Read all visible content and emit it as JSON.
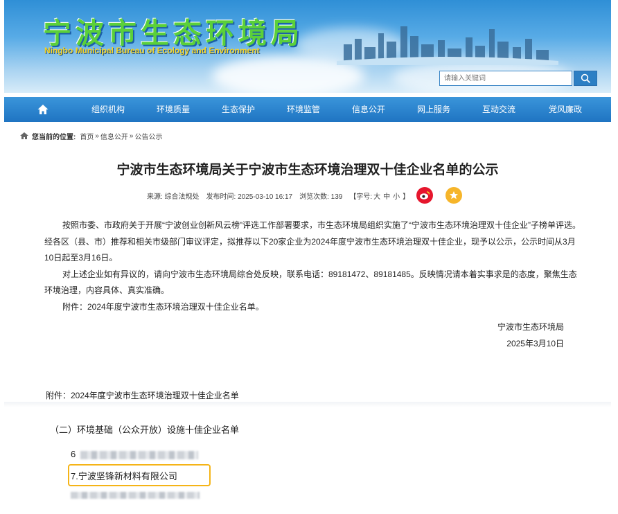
{
  "header": {
    "title_cn": "宁波市生态环境局",
    "title_en": "Ningbo Municipal Bureau of Ecology and Environment",
    "search_placeholder": "请输入关键词"
  },
  "nav": {
    "items": [
      "组织机构",
      "环境质量",
      "生态保护",
      "环境监管",
      "信息公开",
      "网上服务",
      "互动交流",
      "党风廉政"
    ]
  },
  "breadcrumb": {
    "label": "您当前的位置:",
    "home": "首页",
    "sep": "»",
    "level1": "信息公开",
    "level2": "公告公示"
  },
  "article": {
    "title": "宁波市生态环境局关于宁波市生态环境治理双十佳企业名单的公示",
    "meta": {
      "source": "来源:  综合法规处",
      "published": "发布时间:  2025-03-10 16:17",
      "views": "浏览次数:  139",
      "font_label": "【字号:",
      "font_large": "大",
      "font_medium": "中",
      "font_small": "小",
      "font_close": "】"
    },
    "paragraphs": [
      "按照市委、市政府关于开展“宁波创业创新风云榜”评选工作部署要求，市生态环境局组织实施了“宁波市生态环境治理双十佳企业”子榜单评选。经各区（县、市）推荐和相关市级部门审议评定，拟推荐以下20家企业为2024年度宁波市生态环境治理双十佳企业，现予以公示，公示时间从3月10日起至3月16日。",
      "对上述企业如有异议的，请向宁波市生态环境局综合处反映，联系电话：89181472、89181485。反映情况请本着实事求是的态度，聚焦生态环境治理，内容具体、真实准确。",
      "附件：2024年度宁波市生态环境治理双十佳企业名单。"
    ],
    "signature_org": "宁波市生态环境局",
    "signature_date": "2025年3月10日",
    "attachment_heading": "附件：2024年度宁波市生态环境治理双十佳企业名单",
    "sub_heading": "（二）环境基础（公众开放）设施十佳企业名单",
    "items": [
      {
        "num": "6"
      },
      {
        "text": "7.宁波坚锋新材料有限公司"
      }
    ]
  },
  "colors": {
    "nav_bg": "#1f74c2",
    "title_green": "#5bd03a",
    "highlight": "#f5b417",
    "weibo": "#e6162d",
    "star": "#f6b52a"
  }
}
